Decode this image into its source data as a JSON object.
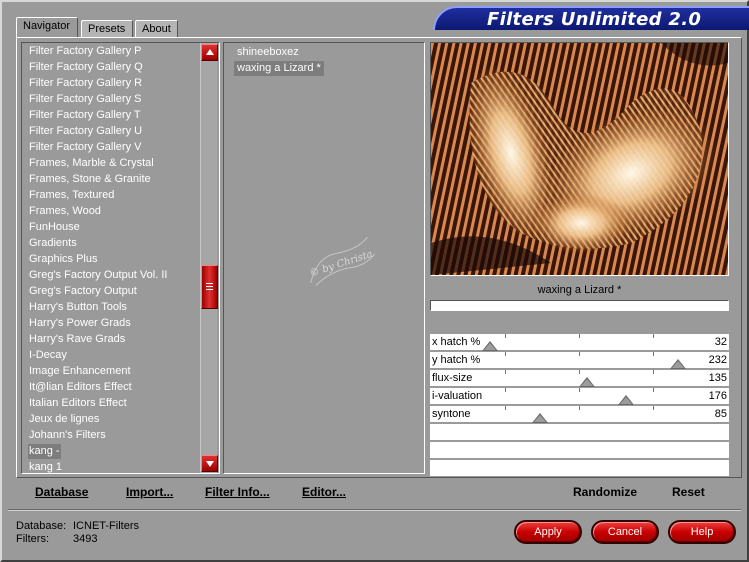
{
  "tabs": [
    "Navigator",
    "Presets",
    "About"
  ],
  "banner_title": "Filters Unlimited 2.0",
  "categories": [
    "Filter Factory Gallery P",
    "Filter Factory Gallery Q",
    "Filter Factory Gallery R",
    "Filter Factory Gallery S",
    "Filter Factory Gallery T",
    "Filter Factory Gallery U",
    "Filter Factory Gallery V",
    "Frames, Marble & Crystal",
    "Frames, Stone & Granite",
    "Frames, Textured",
    "Frames, Wood",
    "FunHouse",
    "Gradients",
    "Graphics Plus",
    "Greg's Factory Output Vol. II",
    "Greg's Factory Output",
    "Harry's Button Tools",
    "Harry's Power Grads",
    "Harry's Rave Grads",
    "I-Decay",
    "Image Enhancement",
    "It@lian Editors Effect",
    "Italian Editors Effect",
    "Jeux de lignes",
    "Johann's Filters",
    "kang -",
    "kang 1"
  ],
  "selected_category": "kang -",
  "filters": [
    "shineeboxez",
    "waxing a Lizard  *"
  ],
  "selected_filter": "waxing a Lizard  *",
  "watermark_text": "© by Christa",
  "preview_caption": "waxing a Lizard  *",
  "sliders": [
    {
      "label": "x hatch %",
      "value": 32,
      "max": 255
    },
    {
      "label": "y hatch %",
      "value": 232,
      "max": 255
    },
    {
      "label": "flux-size",
      "value": 135,
      "max": 255
    },
    {
      "label": "i-valuation",
      "value": 176,
      "max": 255
    },
    {
      "label": "syntone",
      "value": 85,
      "max": 255
    }
  ],
  "buttons": {
    "database": "Database",
    "import": "Import...",
    "filter_info": "Filter Info...",
    "editor": "Editor...",
    "randomize": "Randomize",
    "reset": "Reset",
    "apply": "Apply",
    "cancel": "Cancel",
    "help": "Help"
  },
  "info": {
    "database_label": "Database:",
    "database_value": "ICNET-Filters",
    "filters_label": "Filters:",
    "filters_value": "3493"
  }
}
